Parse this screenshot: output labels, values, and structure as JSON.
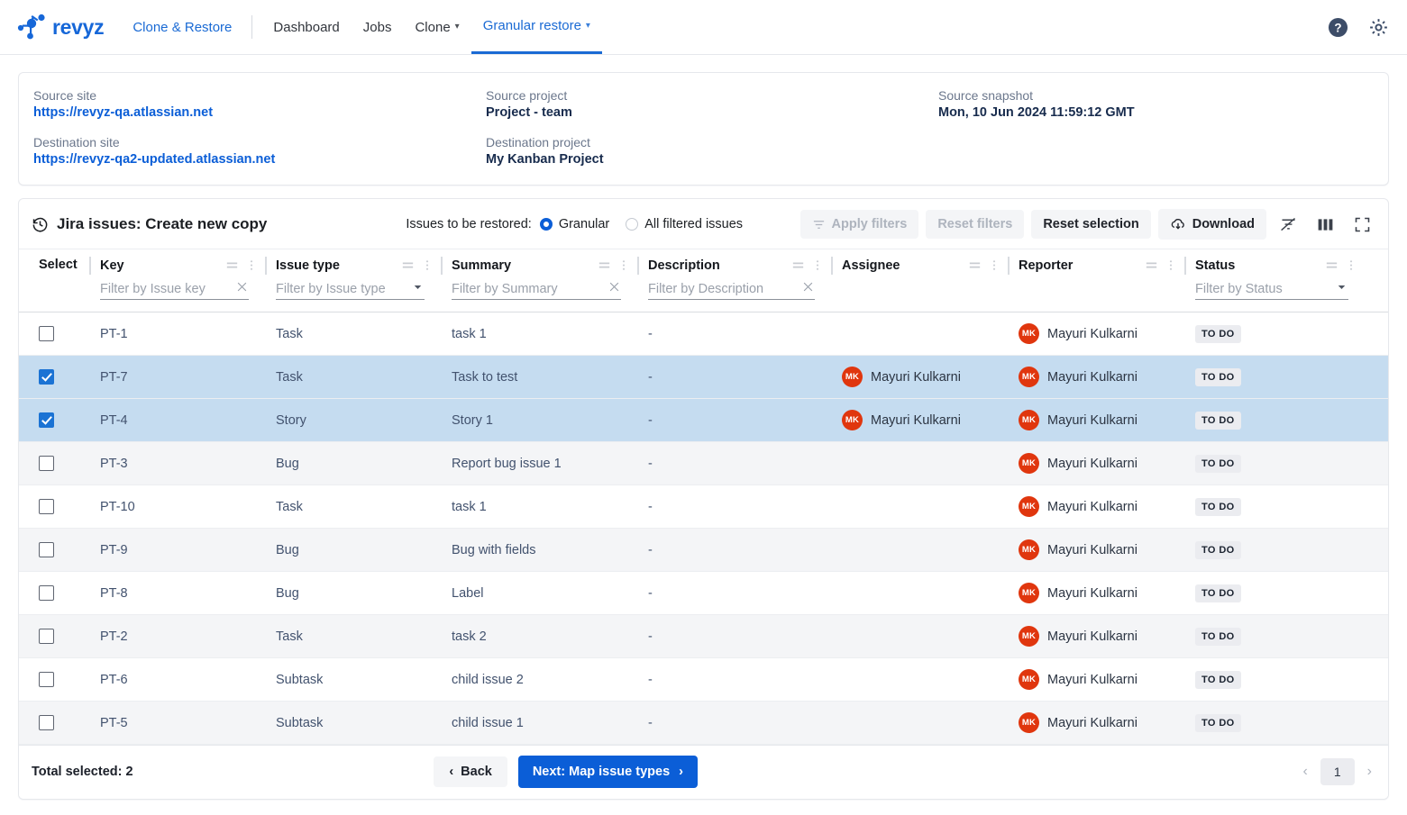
{
  "nav": {
    "brand": "revyz",
    "primary_link": "Clone & Restore",
    "items": [
      {
        "label": "Dashboard",
        "caret": false,
        "active": false
      },
      {
        "label": "Jobs",
        "caret": false,
        "active": false
      },
      {
        "label": "Clone",
        "caret": true,
        "active": false
      },
      {
        "label": "Granular restore",
        "caret": true,
        "active": true
      }
    ],
    "help_icon": "help-circle-icon",
    "settings_icon": "gear-icon"
  },
  "info": {
    "source_site_label": "Source site",
    "source_site_value": "https://revyz-qa.atlassian.net",
    "destination_site_label": "Destination site",
    "destination_site_value": "https://revyz-qa2-updated.atlassian.net",
    "source_project_label": "Source project",
    "source_project_value": "Project - team",
    "destination_project_label": "Destination project",
    "destination_project_value": "My Kanban Project",
    "source_snapshot_label": "Source snapshot",
    "source_snapshot_value": "Mon, 10 Jun 2024 11:59:12 GMT"
  },
  "toolbar": {
    "title": "Jira issues: Create new copy",
    "title_icon": "history-clock-icon",
    "restore_scope_label": "Issues to be restored:",
    "radio_granular": "Granular",
    "radio_all": "All filtered issues",
    "radio_selected": "Granular",
    "apply_filters": "Apply filters",
    "reset_filters": "Reset filters",
    "reset_selection": "Reset selection",
    "download": "Download",
    "clear_filters_icon": "filter-off-icon",
    "columns_icon": "columns-icon",
    "fullscreen_icon": "fullscreen-icon"
  },
  "table": {
    "columns": [
      {
        "key": "select",
        "label": "Select",
        "filter": null,
        "filter_kind": null
      },
      {
        "key": "issue_key",
        "label": "Key",
        "filter": "Filter by Issue key",
        "filter_kind": "clear"
      },
      {
        "key": "issue_type",
        "label": "Issue type",
        "filter": "Filter by Issue type",
        "filter_kind": "dropdown"
      },
      {
        "key": "summary",
        "label": "Summary",
        "filter": "Filter by Summary",
        "filter_kind": "clear"
      },
      {
        "key": "description",
        "label": "Description",
        "filter": "Filter by Description",
        "filter_kind": "clear"
      },
      {
        "key": "assignee",
        "label": "Assignee",
        "filter": null,
        "filter_kind": null
      },
      {
        "key": "reporter",
        "label": "Reporter",
        "filter": null,
        "filter_kind": null
      },
      {
        "key": "status",
        "label": "Status",
        "filter": "Filter by Status",
        "filter_kind": "dropdown"
      }
    ],
    "rows": [
      {
        "selected": false,
        "key": "PT-1",
        "type": "Task",
        "summary": "task 1",
        "description": "-",
        "assignee": "",
        "assignee_initials": "",
        "reporter": "Mayuri Kulkarni",
        "reporter_initials": "MK",
        "status": "TO DO"
      },
      {
        "selected": true,
        "key": "PT-7",
        "type": "Task",
        "summary": "Task to test",
        "description": "-",
        "assignee": "Mayuri Kulkarni",
        "assignee_initials": "MK",
        "reporter": "Mayuri Kulkarni",
        "reporter_initials": "MK",
        "status": "TO DO"
      },
      {
        "selected": true,
        "key": "PT-4",
        "type": "Story",
        "summary": "Story 1",
        "description": "-",
        "assignee": "Mayuri Kulkarni",
        "assignee_initials": "MK",
        "reporter": "Mayuri Kulkarni",
        "reporter_initials": "MK",
        "status": "TO DO"
      },
      {
        "selected": false,
        "key": "PT-3",
        "type": "Bug",
        "summary": "Report bug issue 1",
        "description": "-",
        "assignee": "",
        "assignee_initials": "",
        "reporter": "Mayuri Kulkarni",
        "reporter_initials": "MK",
        "status": "TO DO"
      },
      {
        "selected": false,
        "key": "PT-10",
        "type": "Task",
        "summary": "task 1",
        "description": "-",
        "assignee": "",
        "assignee_initials": "",
        "reporter": "Mayuri Kulkarni",
        "reporter_initials": "MK",
        "status": "TO DO"
      },
      {
        "selected": false,
        "key": "PT-9",
        "type": "Bug",
        "summary": "Bug with fields",
        "description": "-",
        "assignee": "",
        "assignee_initials": "",
        "reporter": "Mayuri Kulkarni",
        "reporter_initials": "MK",
        "status": "TO DO"
      },
      {
        "selected": false,
        "key": "PT-8",
        "type": "Bug",
        "summary": "Label",
        "description": "-",
        "assignee": "",
        "assignee_initials": "",
        "reporter": "Mayuri Kulkarni",
        "reporter_initials": "MK",
        "status": "TO DO"
      },
      {
        "selected": false,
        "key": "PT-2",
        "type": "Task",
        "summary": "task 2",
        "description": "-",
        "assignee": "",
        "assignee_initials": "",
        "reporter": "Mayuri Kulkarni",
        "reporter_initials": "MK",
        "status": "TO DO"
      },
      {
        "selected": false,
        "key": "PT-6",
        "type": "Subtask",
        "summary": "child issue 2",
        "description": "-",
        "assignee": "",
        "assignee_initials": "",
        "reporter": "Mayuri Kulkarni",
        "reporter_initials": "MK",
        "status": "TO DO"
      },
      {
        "selected": false,
        "key": "PT-5",
        "type": "Subtask",
        "summary": "child issue 1",
        "description": "-",
        "assignee": "",
        "assignee_initials": "",
        "reporter": "Mayuri Kulkarni",
        "reporter_initials": "MK",
        "status": "TO DO"
      }
    ]
  },
  "footer": {
    "total_selected": "Total selected: 2",
    "back": "Back",
    "next": "Next: Map issue types",
    "page_current": "1",
    "prev_icon": "chevron-left-icon",
    "next_icon": "chevron-right-icon"
  },
  "colors": {
    "brand_blue": "#1667d8",
    "link_blue": "#0b5ed7",
    "primary_button": "#0b5ed7",
    "selected_row": "#c5dcf0",
    "alt_row": "#f4f5f7",
    "avatar_red": "#e0360e",
    "badge_bg": "#ebecf0"
  }
}
